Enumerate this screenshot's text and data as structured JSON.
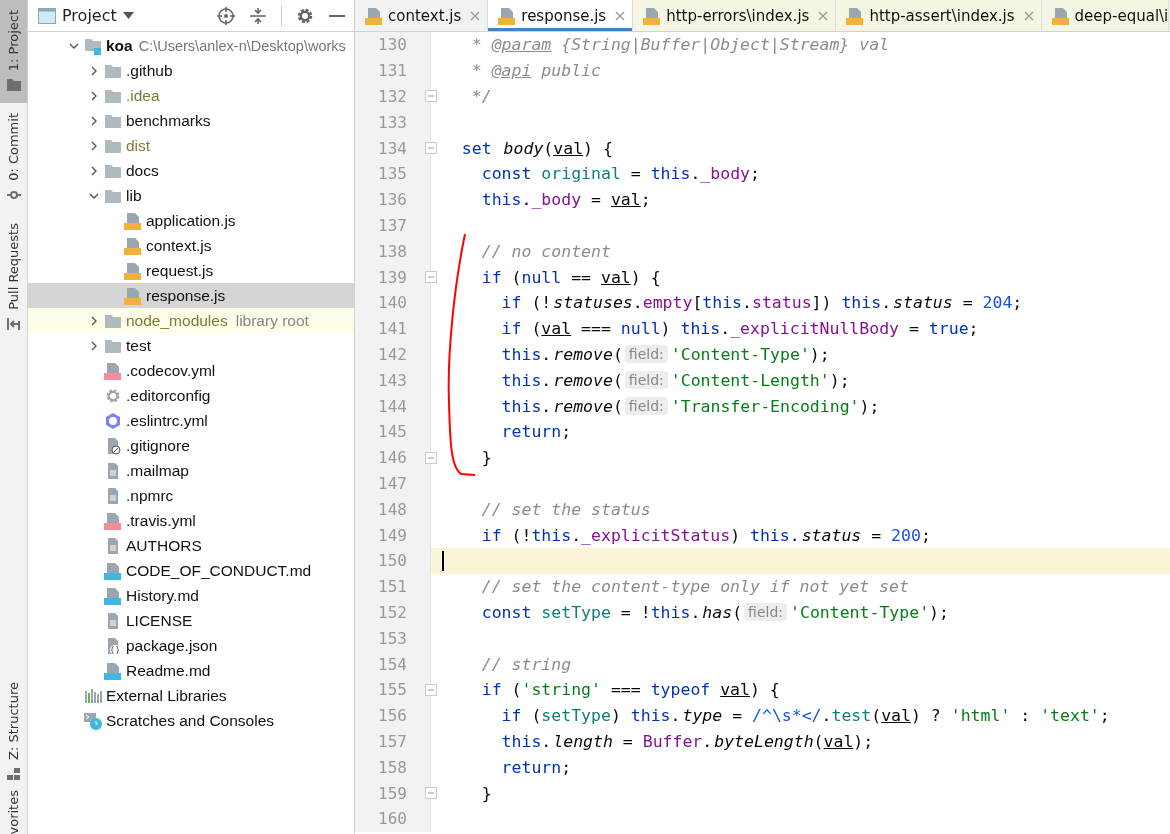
{
  "tool_stripe": {
    "top": [
      {
        "label": "1: Project",
        "selected": true
      },
      {
        "label": "0: Commit",
        "selected": false
      },
      {
        "label": "Pull Requests",
        "selected": false
      }
    ],
    "bottom": [
      {
        "label": "Z: Structure",
        "selected": false
      },
      {
        "label": "vorites",
        "selected": false
      }
    ]
  },
  "project_panel": {
    "title": "Project",
    "tree": [
      {
        "name": "koa",
        "path": "C:\\Users\\anlex-n\\Desktop\\works",
        "kind": "module",
        "expanded": true,
        "selected": false,
        "children": [
          {
            "name": ".github",
            "kind": "folder",
            "expanded": false,
            "excluded": false,
            "selected": false
          },
          {
            "name": ".idea",
            "kind": "folder",
            "expanded": false,
            "excluded": true,
            "selected": false
          },
          {
            "name": "benchmarks",
            "kind": "folder",
            "expanded": false,
            "excluded": false,
            "selected": false
          },
          {
            "name": "dist",
            "kind": "folder",
            "expanded": false,
            "excluded": true,
            "selected": false
          },
          {
            "name": "docs",
            "kind": "folder",
            "expanded": false,
            "excluded": false,
            "selected": false
          },
          {
            "name": "lib",
            "kind": "folder",
            "expanded": true,
            "excluded": false,
            "selected": false,
            "children": [
              {
                "name": "application.js",
                "kind": "js",
                "selected": false
              },
              {
                "name": "context.js",
                "kind": "js",
                "selected": false
              },
              {
                "name": "request.js",
                "kind": "js",
                "selected": false
              },
              {
                "name": "response.js",
                "kind": "js",
                "selected": true
              }
            ]
          },
          {
            "name": "node_modules",
            "suffix": "library root",
            "kind": "library-folder",
            "expanded": false,
            "excluded": true,
            "selected": false
          },
          {
            "name": "test",
            "kind": "folder",
            "expanded": false,
            "excluded": false,
            "selected": false
          },
          {
            "name": ".codecov.yml",
            "kind": "yml",
            "selected": false
          },
          {
            "name": ".editorconfig",
            "kind": "config",
            "selected": false
          },
          {
            "name": ".eslintrc.yml",
            "kind": "eslint",
            "selected": false
          },
          {
            "name": ".gitignore",
            "kind": "gitignore",
            "selected": false
          },
          {
            "name": ".mailmap",
            "kind": "text",
            "selected": false
          },
          {
            "name": ".npmrc",
            "kind": "text",
            "selected": false
          },
          {
            "name": ".travis.yml",
            "kind": "yml",
            "selected": false
          },
          {
            "name": "AUTHORS",
            "kind": "text",
            "selected": false
          },
          {
            "name": "CODE_OF_CONDUCT.md",
            "kind": "md",
            "selected": false
          },
          {
            "name": "History.md",
            "kind": "md",
            "selected": false
          },
          {
            "name": "LICENSE",
            "kind": "text",
            "selected": false
          },
          {
            "name": "package.json",
            "kind": "json",
            "selected": false
          },
          {
            "name": "Readme.md",
            "kind": "md",
            "selected": false
          }
        ]
      },
      {
        "name": "External Libraries",
        "kind": "libraries",
        "selected": false
      },
      {
        "name": "Scratches and Consoles",
        "kind": "scratches",
        "selected": false
      }
    ]
  },
  "editor": {
    "tabs": [
      {
        "label": "context.js",
        "kind": "project",
        "selected": false
      },
      {
        "label": "response.js",
        "kind": "project",
        "selected": true
      },
      {
        "label": "http-errors\\index.js",
        "kind": "library",
        "selected": false
      },
      {
        "label": "http-assert\\index.js",
        "kind": "library",
        "selected": false
      },
      {
        "label": "deep-equal\\i",
        "kind": "library",
        "selected": false
      }
    ],
    "lines": [
      {
        "number": "130",
        "fold": false,
        "current": false,
        "tokens": [
          {
            "kind": "comment",
            "text": "   * "
          },
          {
            "kind": "doctag",
            "text": "@param"
          },
          {
            "kind": "comment",
            "text": " {String|Buffer|Object|Stream} val"
          }
        ]
      },
      {
        "number": "131",
        "fold": false,
        "current": false,
        "tokens": [
          {
            "kind": "comment",
            "text": "   * "
          },
          {
            "kind": "doctag",
            "text": "@api"
          },
          {
            "kind": "comment",
            "text": " public"
          }
        ]
      },
      {
        "number": "132",
        "fold": true,
        "current": false,
        "tokens": [
          {
            "kind": "comment",
            "text": "   */"
          }
        ]
      },
      {
        "number": "133",
        "fold": false,
        "current": false
      },
      {
        "number": "134",
        "fold": true,
        "current": false,
        "tokens": [
          {
            "kind": "keyword",
            "text": "  set "
          },
          {
            "kind": "method",
            "text": "body"
          },
          {
            "kind": "plain",
            "text": "("
          },
          {
            "kind": "param",
            "text": "val"
          },
          {
            "kind": "plain",
            "text": ") {"
          }
        ]
      },
      {
        "number": "135",
        "fold": false,
        "current": false,
        "tokens": [
          {
            "kind": "keyword",
            "text": "    const "
          },
          {
            "kind": "local",
            "text": "original"
          },
          {
            "kind": "plain",
            "text": " = "
          },
          {
            "kind": "keyword",
            "text": "this"
          },
          {
            "kind": "plain",
            "text": "."
          },
          {
            "kind": "field",
            "text": "_body"
          },
          {
            "kind": "plain",
            "text": ";"
          }
        ]
      },
      {
        "number": "136",
        "fold": false,
        "current": false,
        "tokens": [
          {
            "kind": "keyword",
            "text": "    this"
          },
          {
            "kind": "plain",
            "text": "."
          },
          {
            "kind": "field",
            "text": "_body"
          },
          {
            "kind": "plain",
            "text": " = "
          },
          {
            "kind": "param",
            "text": "val"
          },
          {
            "kind": "plain",
            "text": ";"
          }
        ]
      },
      {
        "number": "137",
        "fold": false,
        "current": false
      },
      {
        "number": "138",
        "fold": false,
        "current": false,
        "tokens": [
          {
            "kind": "comment",
            "text": "    // no content"
          }
        ]
      },
      {
        "number": "139",
        "fold": true,
        "current": false,
        "tokens": [
          {
            "kind": "keyword",
            "text": "    if "
          },
          {
            "kind": "plain",
            "text": "("
          },
          {
            "kind": "keyword",
            "text": "null"
          },
          {
            "kind": "plain",
            "text": " == "
          },
          {
            "kind": "param",
            "text": "val"
          },
          {
            "kind": "plain",
            "text": ") {"
          }
        ]
      },
      {
        "number": "140",
        "fold": false,
        "current": false,
        "tokens": [
          {
            "kind": "keyword",
            "text": "      if "
          },
          {
            "kind": "plain",
            "text": "(!"
          },
          {
            "kind": "method",
            "text": "statuses"
          },
          {
            "kind": "plain",
            "text": "."
          },
          {
            "kind": "field",
            "text": "empty"
          },
          {
            "kind": "plain",
            "text": "["
          },
          {
            "kind": "keyword",
            "text": "this"
          },
          {
            "kind": "plain",
            "text": "."
          },
          {
            "kind": "field",
            "text": "status"
          },
          {
            "kind": "plain",
            "text": "]) "
          },
          {
            "kind": "keyword",
            "text": "this"
          },
          {
            "kind": "plain",
            "text": "."
          },
          {
            "kind": "method",
            "text": "status"
          },
          {
            "kind": "plain",
            "text": " = "
          },
          {
            "kind": "number",
            "text": "204"
          },
          {
            "kind": "plain",
            "text": ";"
          }
        ]
      },
      {
        "number": "141",
        "fold": false,
        "current": false,
        "tokens": [
          {
            "kind": "keyword",
            "text": "      if "
          },
          {
            "kind": "plain",
            "text": "("
          },
          {
            "kind": "param",
            "text": "val"
          },
          {
            "kind": "plain",
            "text": " === "
          },
          {
            "kind": "keyword",
            "text": "null"
          },
          {
            "kind": "plain",
            "text": ") "
          },
          {
            "kind": "keyword",
            "text": "this"
          },
          {
            "kind": "plain",
            "text": "."
          },
          {
            "kind": "field",
            "text": "_explicitNullBody"
          },
          {
            "kind": "plain",
            "text": " = "
          },
          {
            "kind": "keyword",
            "text": "true"
          },
          {
            "kind": "plain",
            "text": ";"
          }
        ]
      },
      {
        "number": "142",
        "fold": false,
        "current": false,
        "tokens": [
          {
            "kind": "keyword",
            "text": "      this"
          },
          {
            "kind": "plain",
            "text": "."
          },
          {
            "kind": "method",
            "text": "remove"
          },
          {
            "kind": "plain",
            "text": "("
          },
          {
            "kind": "hint",
            "text": "field:"
          },
          {
            "kind": "string",
            "text": "'Content-Type'"
          },
          {
            "kind": "plain",
            "text": ");"
          }
        ]
      },
      {
        "number": "143",
        "fold": false,
        "current": false,
        "tokens": [
          {
            "kind": "keyword",
            "text": "      this"
          },
          {
            "kind": "plain",
            "text": "."
          },
          {
            "kind": "method",
            "text": "remove"
          },
          {
            "kind": "plain",
            "text": "("
          },
          {
            "kind": "hint",
            "text": "field:"
          },
          {
            "kind": "string",
            "text": "'Content-Length'"
          },
          {
            "kind": "plain",
            "text": ");"
          }
        ]
      },
      {
        "number": "144",
        "fold": false,
        "current": false,
        "tokens": [
          {
            "kind": "keyword",
            "text": "      this"
          },
          {
            "kind": "plain",
            "text": "."
          },
          {
            "kind": "method",
            "text": "remove"
          },
          {
            "kind": "plain",
            "text": "("
          },
          {
            "kind": "hint",
            "text": "field:"
          },
          {
            "kind": "string",
            "text": "'Transfer-Encoding'"
          },
          {
            "kind": "plain",
            "text": ");"
          }
        ]
      },
      {
        "number": "145",
        "fold": false,
        "current": false,
        "tokens": [
          {
            "kind": "keyword",
            "text": "      return"
          },
          {
            "kind": "plain",
            "text": ";"
          }
        ]
      },
      {
        "number": "146",
        "fold": true,
        "current": false,
        "tokens": [
          {
            "kind": "plain",
            "text": "    }"
          }
        ]
      },
      {
        "number": "147",
        "fold": false,
        "current": false
      },
      {
        "number": "148",
        "fold": false,
        "current": false,
        "tokens": [
          {
            "kind": "comment",
            "text": "    // set the status"
          }
        ]
      },
      {
        "number": "149",
        "fold": false,
        "current": false,
        "tokens": [
          {
            "kind": "keyword",
            "text": "    if "
          },
          {
            "kind": "plain",
            "text": "(!"
          },
          {
            "kind": "keyword",
            "text": "this"
          },
          {
            "kind": "plain",
            "text": "."
          },
          {
            "kind": "field",
            "text": "_explicitStatus"
          },
          {
            "kind": "plain",
            "text": ") "
          },
          {
            "kind": "keyword",
            "text": "this"
          },
          {
            "kind": "plain",
            "text": "."
          },
          {
            "kind": "method",
            "text": "status"
          },
          {
            "kind": "plain",
            "text": " = "
          },
          {
            "kind": "number",
            "text": "200"
          },
          {
            "kind": "plain",
            "text": ";"
          }
        ]
      },
      {
        "number": "150",
        "fold": false,
        "current": true
      },
      {
        "number": "151",
        "fold": false,
        "current": false,
        "tokens": [
          {
            "kind": "comment",
            "text": "    // set the content-type only if not yet set"
          }
        ]
      },
      {
        "number": "152",
        "fold": false,
        "current": false,
        "tokens": [
          {
            "kind": "keyword",
            "text": "    const "
          },
          {
            "kind": "local",
            "text": "setType"
          },
          {
            "kind": "plain",
            "text": " = !"
          },
          {
            "kind": "keyword",
            "text": "this"
          },
          {
            "kind": "plain",
            "text": "."
          },
          {
            "kind": "method",
            "text": "has"
          },
          {
            "kind": "plain",
            "text": "("
          },
          {
            "kind": "hint",
            "text": "field:"
          },
          {
            "kind": "string",
            "text": "'Content-Type'"
          },
          {
            "kind": "plain",
            "text": ");"
          }
        ]
      },
      {
        "number": "153",
        "fold": false,
        "current": false
      },
      {
        "number": "154",
        "fold": false,
        "current": false,
        "tokens": [
          {
            "kind": "comment",
            "text": "    // string"
          }
        ]
      },
      {
        "number": "155",
        "fold": true,
        "current": false,
        "tokens": [
          {
            "kind": "keyword",
            "text": "    if "
          },
          {
            "kind": "plain",
            "text": "("
          },
          {
            "kind": "string",
            "text": "'string'"
          },
          {
            "kind": "plain",
            "text": " === "
          },
          {
            "kind": "keyword",
            "text": "typeof "
          },
          {
            "kind": "param",
            "text": "val"
          },
          {
            "kind": "plain",
            "text": ") {"
          }
        ]
      },
      {
        "number": "156",
        "fold": false,
        "current": false,
        "tokens": [
          {
            "kind": "keyword",
            "text": "      if "
          },
          {
            "kind": "plain",
            "text": "("
          },
          {
            "kind": "local",
            "text": "setType"
          },
          {
            "kind": "plain",
            "text": ") "
          },
          {
            "kind": "keyword",
            "text": "this"
          },
          {
            "kind": "plain",
            "text": "."
          },
          {
            "kind": "method",
            "text": "type"
          },
          {
            "kind": "plain",
            "text": " = "
          },
          {
            "kind": "regex",
            "text": "/^\\s*</"
          },
          {
            "kind": "plain",
            "text": "."
          },
          {
            "kind": "local",
            "text": "test"
          },
          {
            "kind": "plain",
            "text": "("
          },
          {
            "kind": "param",
            "text": "val"
          },
          {
            "kind": "plain",
            "text": ") ? "
          },
          {
            "kind": "string",
            "text": "'html'"
          },
          {
            "kind": "plain",
            "text": " : "
          },
          {
            "kind": "string",
            "text": "'text'"
          },
          {
            "kind": "plain",
            "text": ";"
          }
        ]
      },
      {
        "number": "157",
        "fold": false,
        "current": false,
        "tokens": [
          {
            "kind": "keyword",
            "text": "      this"
          },
          {
            "kind": "plain",
            "text": "."
          },
          {
            "kind": "method",
            "text": "length"
          },
          {
            "kind": "plain",
            "text": " = "
          },
          {
            "kind": "field",
            "text": "Buffer"
          },
          {
            "kind": "plain",
            "text": "."
          },
          {
            "kind": "method",
            "text": "byteLength"
          },
          {
            "kind": "plain",
            "text": "("
          },
          {
            "kind": "param",
            "text": "val"
          },
          {
            "kind": "plain",
            "text": ");"
          }
        ]
      },
      {
        "number": "158",
        "fold": false,
        "current": false,
        "tokens": [
          {
            "kind": "keyword",
            "text": "      return"
          },
          {
            "kind": "plain",
            "text": ";"
          }
        ]
      },
      {
        "number": "159",
        "fold": true,
        "current": false,
        "tokens": [
          {
            "kind": "plain",
            "text": "    }"
          }
        ]
      },
      {
        "number": "160",
        "fold": false,
        "current": false
      }
    ]
  }
}
